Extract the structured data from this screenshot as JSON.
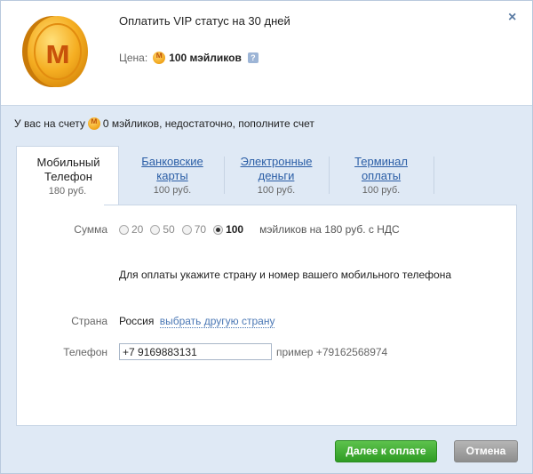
{
  "header": {
    "title": "Оплатить VIP статус на 30 дней",
    "price_label": "Цена:",
    "price_value": "100 мэйликов",
    "help": "?",
    "close": "×"
  },
  "balance": {
    "prefix": "У вас на счету",
    "text": "0 мэйликов, недостаточно, пополните счет"
  },
  "tabs": [
    {
      "label": "Мобильный Телефон",
      "price": "180 руб.",
      "active": true
    },
    {
      "label": "Банковские карты",
      "price": "100 руб.",
      "active": false
    },
    {
      "label": "Электронные деньги",
      "price": "100 руб.",
      "active": false
    },
    {
      "label": "Терминал оплаты",
      "price": "100 руб.",
      "active": false
    }
  ],
  "form": {
    "sum_label": "Сумма",
    "sum_options": [
      "20",
      "50",
      "70",
      "100"
    ],
    "sum_selected": "100",
    "sum_description": "мэйликов на 180 руб. с НДС",
    "instruction": "Для оплаты укажите страну и номер вашего мобильного телефона",
    "country_label": "Страна",
    "country_value": "Россия",
    "country_link": "выбрать другую страну",
    "phone_label": "Телефон",
    "phone_value": "+7 9169883131",
    "phone_example": "пример +79162568974"
  },
  "buttons": {
    "pay": "Далее к оплате",
    "cancel": "Отмена"
  },
  "colors": {
    "accent_link": "#2b5ea6",
    "pay_button": "#3aa62c",
    "cancel_button": "#9e9e9e",
    "coin": "#f0a41a"
  }
}
